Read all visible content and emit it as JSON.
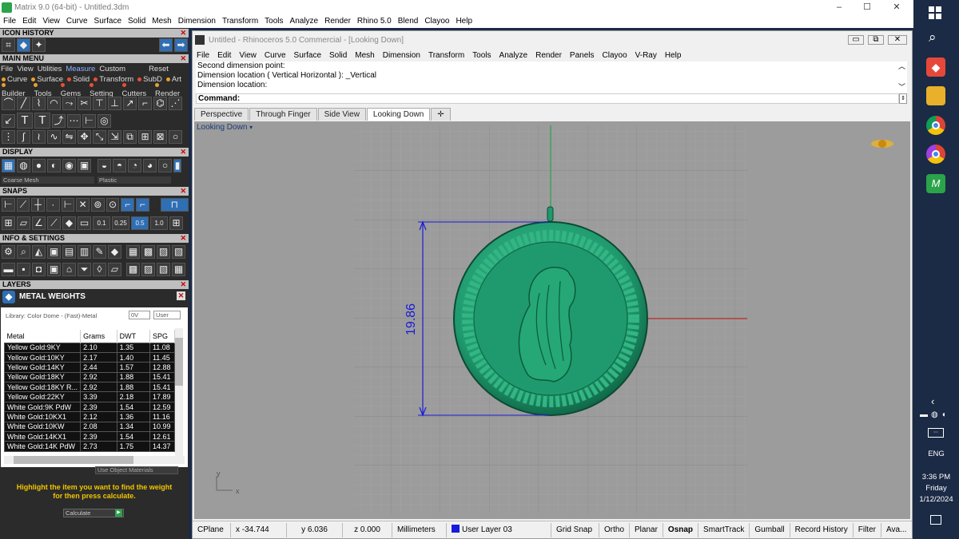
{
  "window": {
    "title": "Matrix 9.0 (64-bit) - Untitled.3dm",
    "minimize": "–",
    "maximize": "☐",
    "close": "✕"
  },
  "menubar": [
    "File",
    "Edit",
    "View",
    "Curve",
    "Surface",
    "Solid",
    "Mesh",
    "Dimension",
    "Transform",
    "Tools",
    "Analyze",
    "Render",
    "Rhino 5.0",
    "Blend",
    "Clayoo",
    "Help"
  ],
  "left": {
    "icon_history": "ICON HISTORY",
    "main_menu": "MAIN MENU",
    "mm_row1": [
      "File",
      "View",
      "Utilities",
      "Measure",
      "Custom",
      "Reset"
    ],
    "mm_row2": [
      "Curve",
      "Surface",
      "Solid",
      "Transform",
      "SubD",
      "Art"
    ],
    "mm_row3": [
      "Builder",
      "Tools",
      "Gems",
      "Setting",
      "Cutters",
      "Render"
    ],
    "display": "DISPLAY",
    "display_opt1": "Coarse Mesh",
    "display_opt2": "Plastic",
    "snaps": "SNAPS",
    "snap_values": [
      "0.1",
      "0.25",
      "0.5",
      "1.0"
    ],
    "info": "INFO & SETTINGS",
    "layers": "LAYERS",
    "metal_weights": "METAL WEIGHTS",
    "library": "Library: Color Dome - (Fast)-Metal",
    "ov": "0V",
    "user": "User",
    "columns": [
      "Metal",
      "Grams",
      "DWT",
      "SPG"
    ],
    "rows": [
      [
        "Yellow Gold:9KY",
        "2.10",
        "1.35",
        "11.08"
      ],
      [
        "Yellow Gold:10KY",
        "2.17",
        "1.40",
        "11.45"
      ],
      [
        "Yellow Gold:14KY",
        "2.44",
        "1.57",
        "12.88"
      ],
      [
        "Yellow Gold:18KY",
        "2.92",
        "1.88",
        "15.41"
      ],
      [
        "Yellow Gold:18KY R...",
        "2.92",
        "1.88",
        "15.41"
      ],
      [
        "Yellow Gold:22KY",
        "3.39",
        "2.18",
        "17.89"
      ],
      [
        "White Gold:9K PdW",
        "2.39",
        "1.54",
        "12.59"
      ],
      [
        "White Gold:10KX1",
        "2.12",
        "1.36",
        "11.16"
      ],
      [
        "White Gold:10KW",
        "2.08",
        "1.34",
        "10.99"
      ],
      [
        "White Gold:14KX1",
        "2.39",
        "1.54",
        "12.61"
      ],
      [
        "White Gold:14K PdW",
        "2.73",
        "1.75",
        "14.37"
      ]
    ],
    "use_object_materials": "Use Object Materials",
    "hint_line1": "Highlight the item you want to find the weight",
    "hint_line2": "for then press calculate.",
    "calculate": "Calculate"
  },
  "rhino": {
    "title": "Untitled - Rhinoceros 5.0 Commercial - [Looking Down]",
    "menu": [
      "File",
      "Edit",
      "View",
      "Curve",
      "Surface",
      "Solid",
      "Mesh",
      "Dimension",
      "Transform",
      "Tools",
      "Analyze",
      "Render",
      "Panels",
      "Clayoo",
      "V-Ray",
      "Help"
    ],
    "history": [
      "Second dimension point:",
      "Dimension location ( Vertical  Horizontal ): _Vertical",
      "Dimension location:"
    ],
    "command_label": "Command:",
    "tabs": [
      "Perspective",
      "Through Finger",
      "Side View",
      "Looking Down"
    ],
    "active_tab": "Looking Down",
    "viewport_label": "Looking Down",
    "dimension": "19.86",
    "axis_y": "y",
    "axis_x": "x",
    "status": {
      "cplane": "CPlane",
      "x": "x -34.744",
      "y": "y 6.036",
      "z": "z 0.000",
      "units": "Millimeters",
      "layer": "User Layer 03",
      "items": [
        "Grid Snap",
        "Ortho",
        "Planar",
        "Osnap",
        "SmartTrack",
        "Gumball",
        "Record History",
        "Filter",
        "Ava..."
      ]
    }
  },
  "taskbar": {
    "lang": "ENG",
    "time": "3:36 PM",
    "day": "Friday",
    "date": "1/12/2024"
  },
  "colors": {
    "pendant": "#1f9a6e",
    "dimension": "#1a1adb",
    "panel": "#2b2b2b",
    "taskbar": "#1b2a45"
  }
}
